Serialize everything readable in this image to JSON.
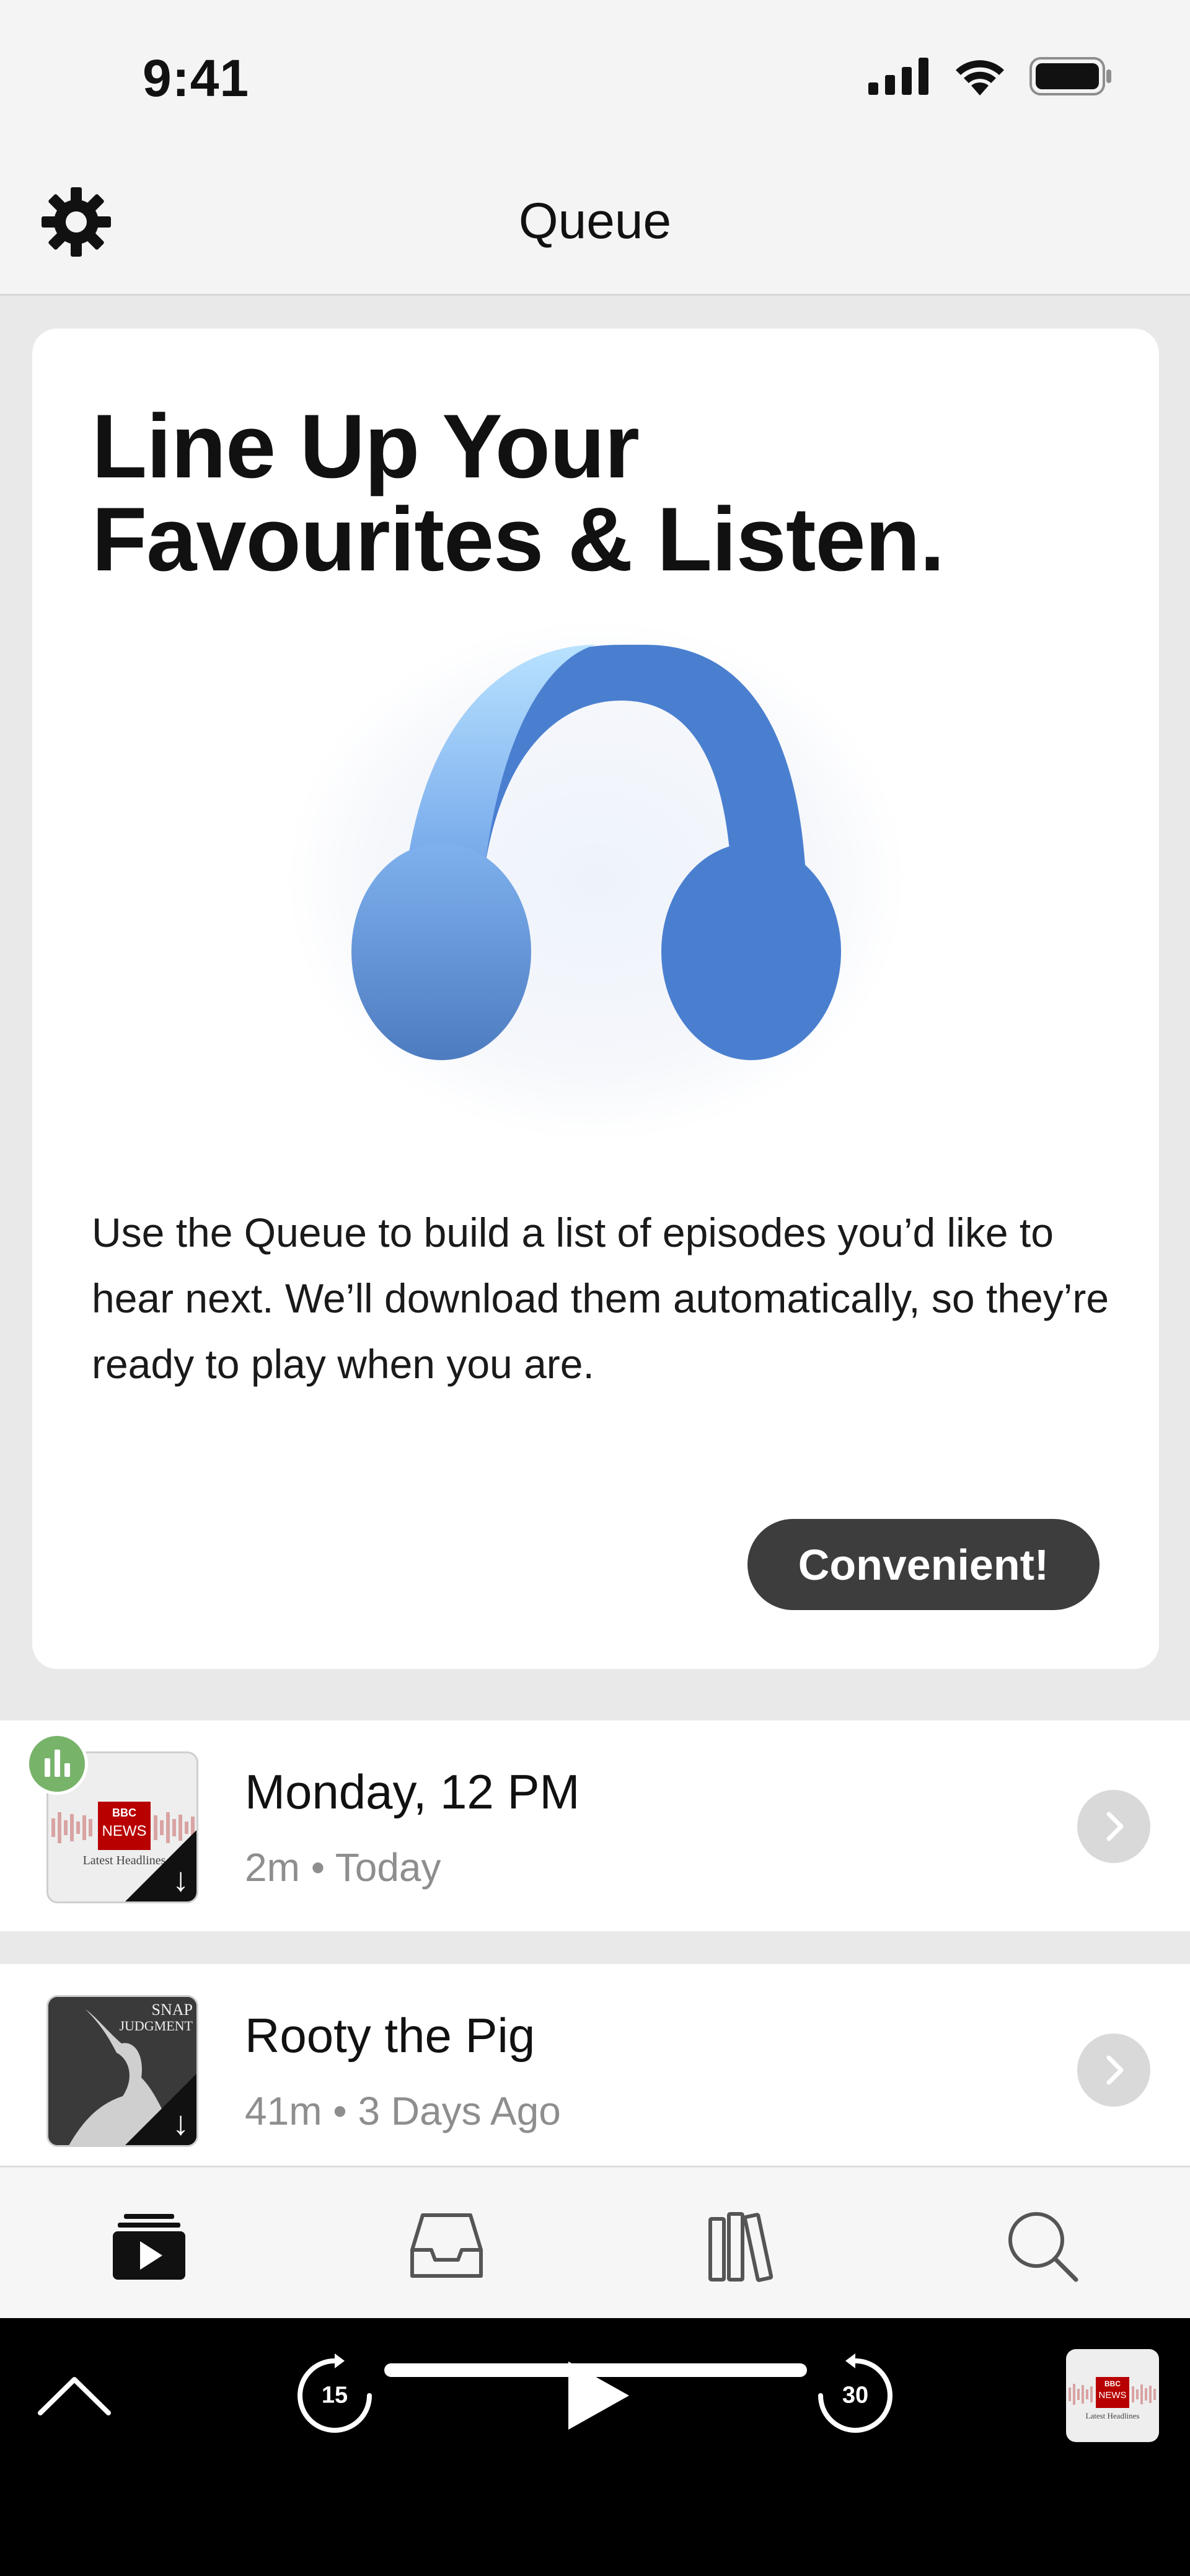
{
  "status_bar": {
    "time": "9:41"
  },
  "nav": {
    "title": "Queue"
  },
  "promo": {
    "title_line1": "Line Up Your",
    "title_line2": "Favourites & Listen.",
    "body": "Use the Queue to build a list of episodes you’d like to hear next. We’ll download them automatically, so they’re ready to play when you are.",
    "button_label": "Convenient!"
  },
  "episodes": [
    {
      "title": "Monday, 12 PM",
      "meta": "2m • Today",
      "art_brand_top": "BBC",
      "art_brand_bottom": "NEWS",
      "art_caption": "Latest Headlines",
      "now_playing": true
    },
    {
      "title": "Rooty the Pig",
      "meta": "41m • 3 Days Ago",
      "art_caption_1": "SNAP",
      "art_caption_2": "JUDGMENT",
      "now_playing": false
    }
  ],
  "tabs": [
    {
      "name": "tab-queue",
      "icon": "queue-icon",
      "active": true
    },
    {
      "name": "tab-inbox",
      "icon": "inbox-icon",
      "active": false
    },
    {
      "name": "tab-library",
      "icon": "library-icon",
      "active": false
    },
    {
      "name": "tab-search",
      "icon": "search-icon",
      "active": false
    }
  ],
  "player": {
    "skip_back_seconds": "15",
    "skip_forward_seconds": "30",
    "mini_art_brand_top": "BBC",
    "mini_art_brand_bottom": "NEWS",
    "mini_art_caption": "Latest Headlines"
  },
  "colors": {
    "accent_blue": "#4a7fd0",
    "button_dark": "#3d3d3d",
    "badge_green": "#78b36a",
    "bbc_red": "#b80000"
  }
}
